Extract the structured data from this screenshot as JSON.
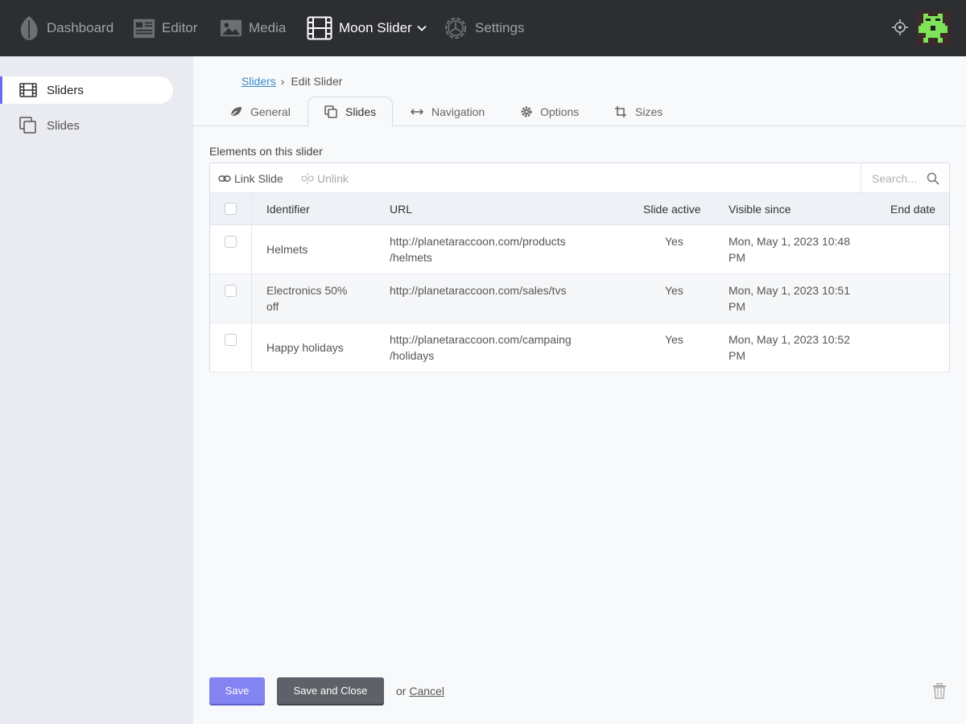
{
  "topnav": {
    "items": [
      {
        "label": "Dashboard",
        "icon": "leaf-icon"
      },
      {
        "label": "Editor",
        "icon": "newspaper-icon"
      },
      {
        "label": "Media",
        "icon": "image-icon"
      },
      {
        "label": "Moon Slider",
        "icon": "film-icon",
        "active": true
      },
      {
        "label": "Settings",
        "icon": "gear-icon"
      }
    ]
  },
  "sidebar": {
    "items": [
      {
        "label": "Sliders",
        "icon": "film-icon",
        "active": true
      },
      {
        "label": "Slides",
        "icon": "copy-icon"
      }
    ]
  },
  "breadcrumb": {
    "link": "Sliders",
    "separator": "›",
    "current": "Edit Slider"
  },
  "tabs": [
    {
      "label": "General",
      "icon": "leaf-icon"
    },
    {
      "label": "Slides",
      "icon": "copy-icon",
      "active": true
    },
    {
      "label": "Navigation",
      "icon": "arrows-horizontal-icon"
    },
    {
      "label": "Options",
      "icon": "gear-icon"
    },
    {
      "label": "Sizes",
      "icon": "crop-icon"
    }
  ],
  "section_label": "Elements on this slider",
  "toolbar": {
    "link_label": "Link Slide",
    "unlink_label": "Unlink",
    "search_placeholder": "Search..."
  },
  "table": {
    "headers": {
      "identifier": "Identifier",
      "url": "URL",
      "active": "Slide active",
      "since": "Visible since",
      "end": "End date"
    },
    "rows": [
      {
        "identifier": "Helmets",
        "url": "http://planetaraccoon.com/products\n/helmets",
        "active": "Yes",
        "since": "Mon, May 1, 2023 10:48\nPM",
        "end": ""
      },
      {
        "identifier": "Electronics 50%\noff",
        "url": "http://planetaraccoon.com/sales/tvs",
        "active": "Yes",
        "since": "Mon, May 1, 2023 10:51\nPM",
        "end": ""
      },
      {
        "identifier": "Happy holidays",
        "url": "http://planetaraccoon.com/campaing\n/holidays",
        "active": "Yes",
        "since": "Mon, May 1, 2023 10:52\nPM",
        "end": ""
      }
    ]
  },
  "footer": {
    "save_label": "Save",
    "save_close_label": "Save and Close",
    "or_text": "or",
    "cancel_label": "Cancel"
  },
  "colors": {
    "topbar": "#2c2e31",
    "accent": "#8383f2",
    "link": "#3a8cc9"
  }
}
